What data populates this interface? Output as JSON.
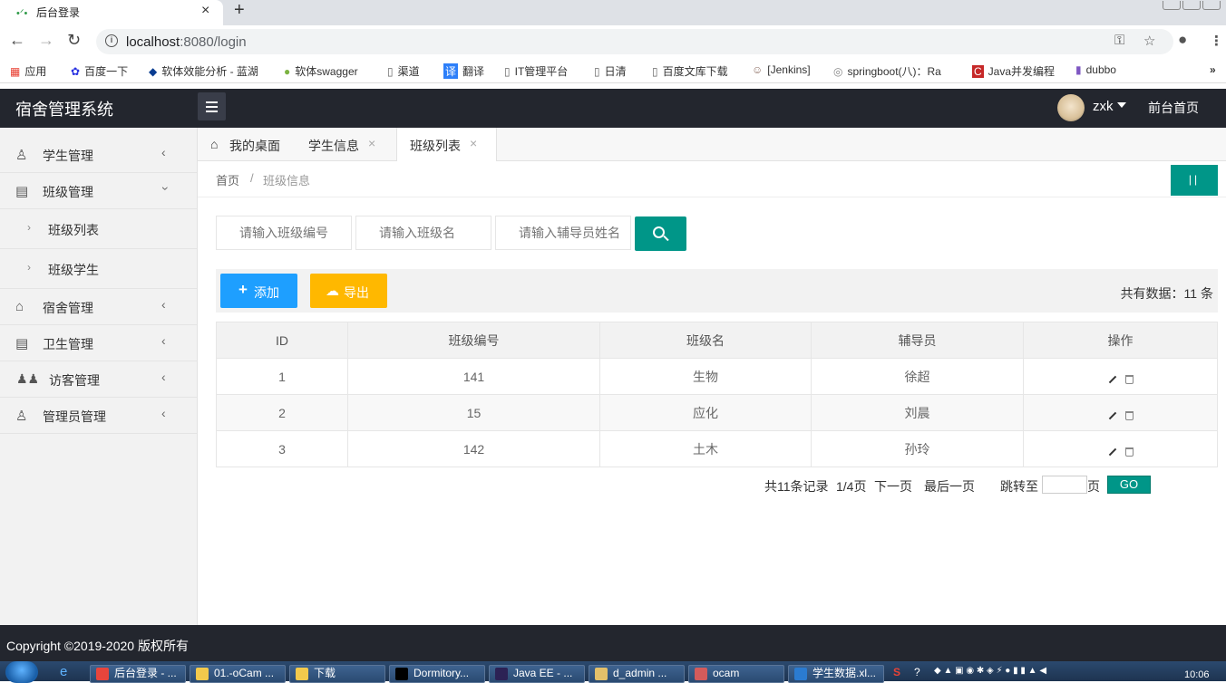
{
  "browser": {
    "tab_title": "后台登录",
    "url_host": "localhost",
    "url_rest": ":8080/login",
    "bookmarks": [
      "应用",
      "百度一下",
      "软体效能分析 - 蓝湖",
      "软体swagger",
      "渠道",
      "翻译",
      "IT管理平台",
      "日清",
      "百度文库下载",
      "[Jenkins]",
      "springboot(八)：Ra",
      "Java并发编程",
      "dubbo"
    ]
  },
  "header": {
    "title": "宿舍管理系统",
    "username": "zxk",
    "front_link": "前台首页"
  },
  "sidebar": {
    "items": [
      {
        "label": "学生管理"
      },
      {
        "label": "班级管理"
      },
      {
        "label": "宿舍管理"
      },
      {
        "label": "卫生管理"
      },
      {
        "label": "访客管理"
      },
      {
        "label": "管理员管理"
      }
    ],
    "subitems": [
      {
        "label": "班级列表"
      },
      {
        "label": "班级学生"
      }
    ]
  },
  "tabs": [
    {
      "label": "我的桌面"
    },
    {
      "label": "学生信息"
    },
    {
      "label": "班级列表"
    }
  ],
  "breadcrumb": {
    "home": "首页",
    "sep": "/",
    "current": "班级信息"
  },
  "search": {
    "class_no_placeholder": "请输入班级编号",
    "class_name_placeholder": "请输入班级名",
    "counselor_placeholder": "请输入辅导员姓名"
  },
  "toolbar": {
    "add_label": "添加",
    "export_label": "导出",
    "total_text": "共有数据：11 条"
  },
  "table": {
    "headers": [
      "ID",
      "班级编号",
      "班级名",
      "辅导员",
      "操作"
    ],
    "rows": [
      {
        "id": "1",
        "class_no": "141",
        "name": "生物",
        "counselor": "徐超"
      },
      {
        "id": "2",
        "class_no": "15",
        "name": "应化",
        "counselor": "刘晨"
      },
      {
        "id": "3",
        "class_no": "142",
        "name": "土木",
        "counselor": "孙玲"
      }
    ]
  },
  "pager": {
    "records": "共11条记录",
    "page": "1/4页",
    "next": "下一页",
    "last": "最后一页",
    "jump_label": "跳转至",
    "page_unit": "页",
    "go": "GO"
  },
  "footer": {
    "copyright": "Copyright ©2019-2020 版权所有"
  },
  "taskbar": {
    "items": [
      "后台登录 - ...",
      "01.-oCam ...",
      "下载",
      "Dormitory...",
      "Java EE - ...",
      "d_admin ...",
      "ocam",
      "学生数据.xl..."
    ],
    "clock": "10:06"
  },
  "colors": {
    "header_bg": "#23262e",
    "teal": "#009688",
    "blue": "#1e9fff",
    "orange": "#ffb800"
  }
}
